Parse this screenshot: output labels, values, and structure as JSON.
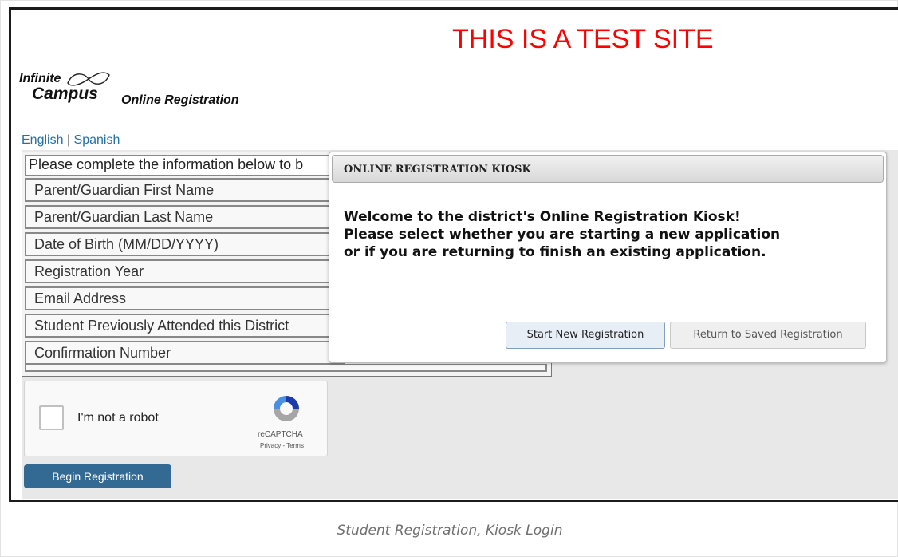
{
  "banner": {
    "text": "THIS IS A TEST SITE",
    "color": "#ff0000"
  },
  "logo": {
    "line1": "Infinite",
    "line2": "Campus",
    "product": "Online Registration",
    "icon": "infinity-swoosh-icon"
  },
  "language": {
    "english": "English",
    "separator": "|",
    "spanish": "Spanish"
  },
  "form": {
    "intro": "Please complete the information below to b",
    "fields": [
      "Parent/Guardian First Name",
      "Parent/Guardian Last Name",
      "Date of Birth (MM/DD/YYYY)",
      "Registration Year",
      "Email Address",
      "Student Previously Attended this District",
      "Confirmation Number"
    ]
  },
  "recaptcha": {
    "label": "I'm not a robot",
    "brand": "reCAPTCHA",
    "links": "Privacy - Terms",
    "icon": "recaptcha-icon"
  },
  "begin_button": "Begin Registration",
  "modal": {
    "title": "ONLINE REGISTRATION KIOSK",
    "message_lines": [
      "Welcome to the district's Online Registration Kiosk!",
      "Please select whether you are starting a new application",
      "or if you are returning to finish an existing application."
    ],
    "start_button": "Start New Registration",
    "return_button": "Return to Saved Registration"
  },
  "caption": "Student Registration, Kiosk Login",
  "colors": {
    "accent": "#336a93",
    "link": "#2470a8",
    "panel_gray": "#e8e8e8"
  }
}
